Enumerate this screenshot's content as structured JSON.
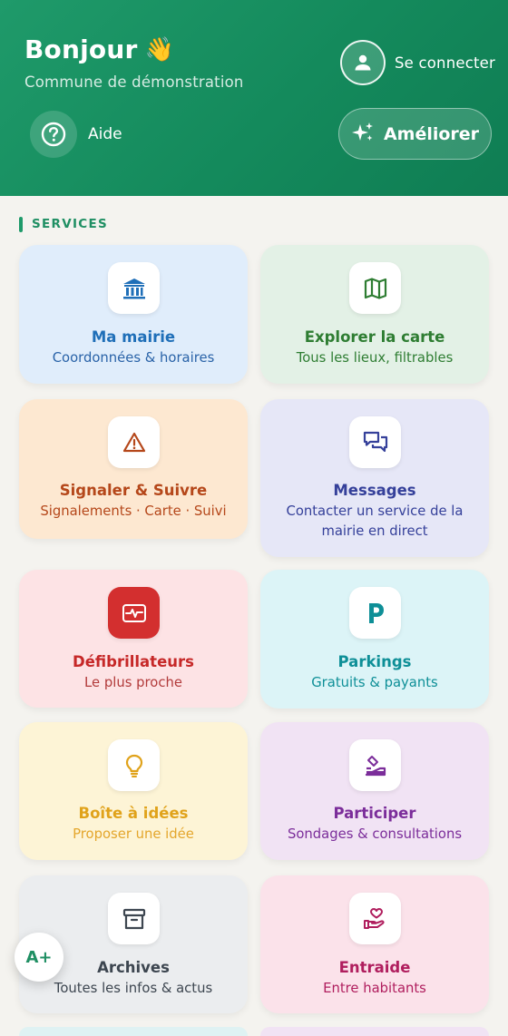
{
  "header": {
    "greeting": "Bonjour",
    "greeting_emoji": "👋",
    "subtitle": "Commune de démonstration",
    "login_label": "Se connecter",
    "help_label": "Aide",
    "improve_label": "Améliorer"
  },
  "services": {
    "section_title": "SERVICES",
    "cards": [
      {
        "title": "Ma mairie",
        "subtitle": "Coordonnées & horaires",
        "icon": "town-hall-icon",
        "color": "#1f6fb8"
      },
      {
        "title": "Explorer la carte",
        "subtitle": "Tous les lieux, filtrables",
        "icon": "map-icon",
        "color": "#2e7d32"
      },
      {
        "title": "Signaler & Suivre",
        "subtitle": "Signalements · Carte · Suivi",
        "icon": "warning-icon",
        "color": "#b5471a"
      },
      {
        "title": "Messages",
        "subtitle": "Contacter un service de la mairie en direct",
        "icon": "chat-icon",
        "color": "#35409a"
      },
      {
        "title": "Défibrillateurs",
        "subtitle": "Le plus proche",
        "icon": "defibrillator-icon",
        "color": "#c62828"
      },
      {
        "title": "Parkings",
        "subtitle": "Gratuits & payants",
        "icon": "parking-icon",
        "color": "#0e8f97"
      },
      {
        "title": "Boîte à idées",
        "subtitle": "Proposer une idée",
        "icon": "lightbulb-icon",
        "color": "#e0a21a"
      },
      {
        "title": "Participer",
        "subtitle": "Sondages & consultations",
        "icon": "vote-icon",
        "color": "#7b2d9a"
      },
      {
        "title": "Archives",
        "subtitle": "Toutes les infos & actus",
        "icon": "archive-icon",
        "color": "#3d4650"
      },
      {
        "title": "Entraide",
        "subtitle": "Entre habitants",
        "icon": "heart-hand-icon",
        "color": "#b01e5e"
      }
    ]
  },
  "accessibility": {
    "font_size_label": "A+"
  },
  "colors": {
    "brand": "#1f9a6a",
    "background": "#f4f3ef"
  }
}
